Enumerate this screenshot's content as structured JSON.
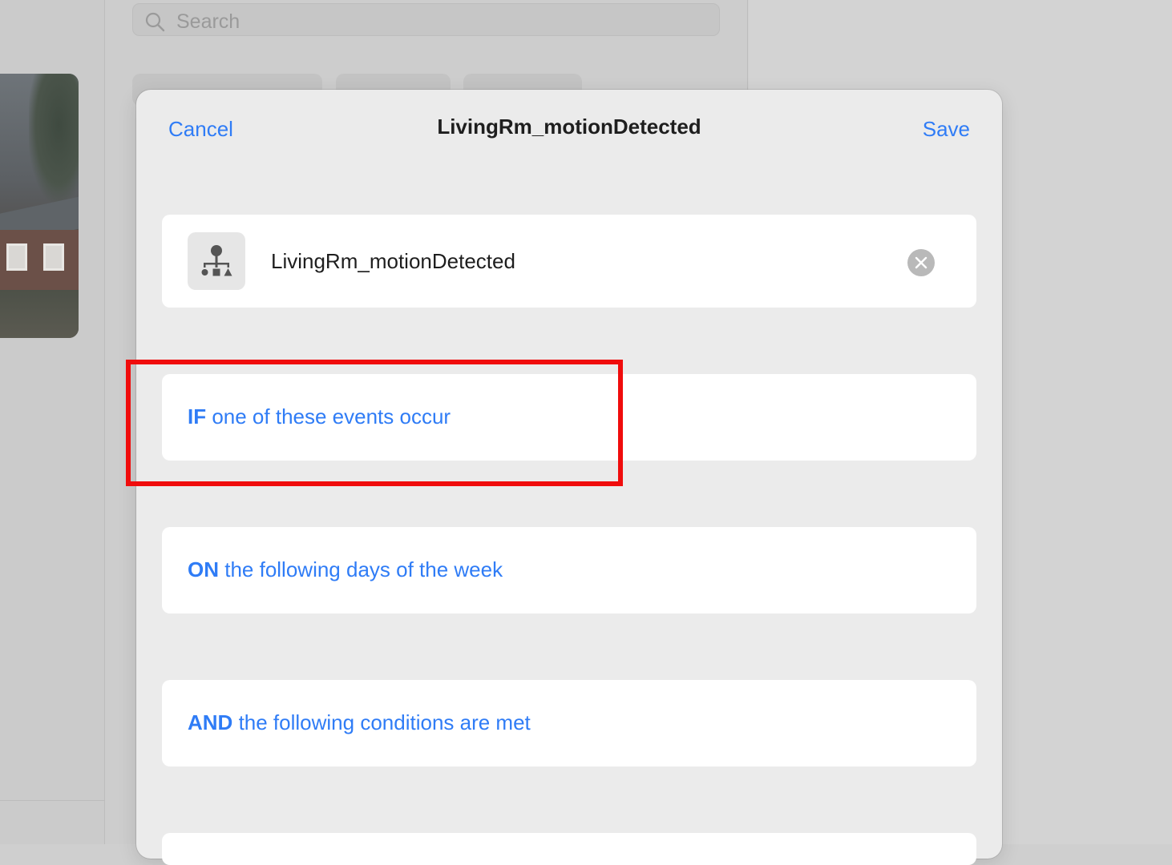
{
  "background": {
    "search_placeholder": "Search"
  },
  "sheet": {
    "cancel_label": "Cancel",
    "title": "LivingRm_motionDetected",
    "save_label": "Save",
    "name_field": {
      "value": "LivingRm_motionDetected",
      "icon": "automation-hierarchy-icon"
    },
    "sections": {
      "if": {
        "keyword": "IF",
        "text": " one of these events occur"
      },
      "on": {
        "keyword": "ON",
        "text": " the following days of the week"
      },
      "and": {
        "keyword": "AND",
        "text": " the following conditions are met"
      }
    }
  },
  "colors": {
    "accent": "#2f7cf6",
    "highlight": "#f00c0c"
  }
}
